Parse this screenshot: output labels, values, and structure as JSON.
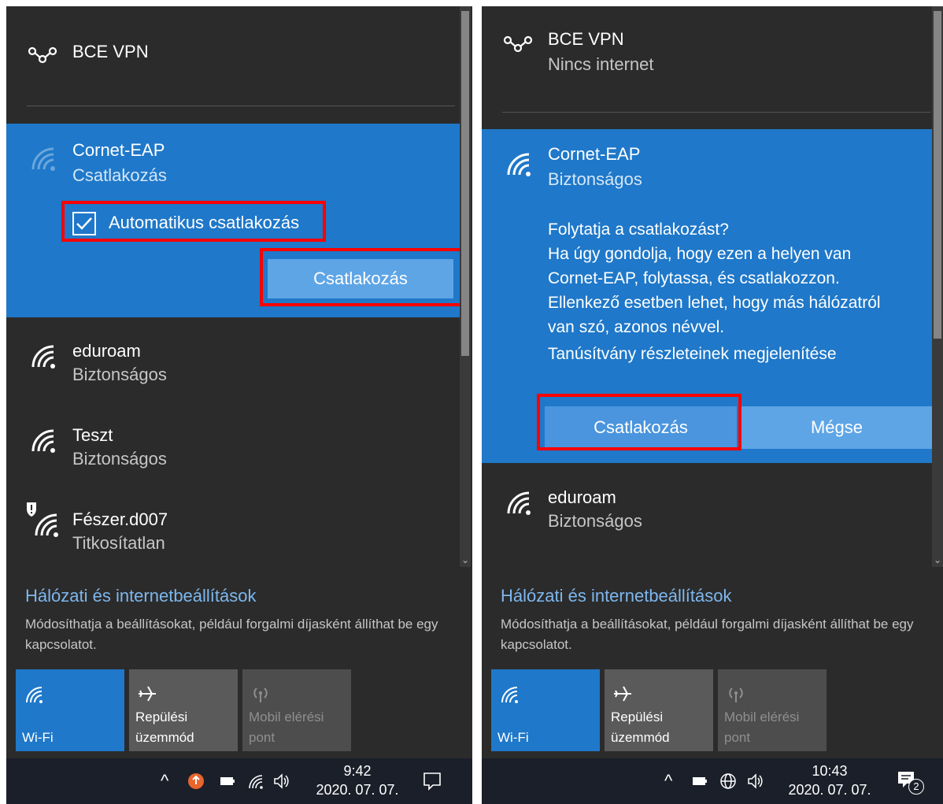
{
  "left_panel": {
    "vpn": {
      "name": "BCE VPN"
    },
    "selected_network": {
      "name": "Cornet-EAP",
      "status": "Csatlakozás",
      "auto_connect_label": "Automatikus csatlakozás",
      "auto_connect_checked": true,
      "connect_button": "Csatlakozás"
    },
    "networks": [
      {
        "name": "eduroam",
        "status": "Biztonságos"
      },
      {
        "name": "Teszt",
        "status": "Biztonságos"
      },
      {
        "name": "Fészer.d007",
        "status": "Titkosítatlan"
      }
    ],
    "settings": {
      "link": "Hálózati és internetbeállítások",
      "description": "Módosíthatja a beállításokat, például forgalmi díjasként állíthat be egy kapcsolatot."
    },
    "tiles": [
      {
        "label": "Wi-Fi",
        "icon": "wifi-icon",
        "active": true
      },
      {
        "label": "Repülési üzemmód",
        "icon": "airplane-icon",
        "active": false
      },
      {
        "label": "Mobil elérési pont",
        "icon": "hotspot-icon",
        "active": false
      }
    ],
    "taskbar": {
      "time": "9:42",
      "date": "2020. 07. 07."
    }
  },
  "right_panel": {
    "vpn": {
      "name": "BCE VPN",
      "status": "Nincs internet"
    },
    "selected_network": {
      "name": "Cornet-EAP",
      "status": "Biztonságos",
      "prompt_lines": [
        "Folytatja a csatlakozást?",
        "Ha úgy gondolja, hogy ezen a helyen van",
        "Cornet-EAP, folytassa, és csatlakozzon.",
        "Ellenkező esetben lehet, hogy más hálózatról",
        "van szó, azonos névvel.",
        "Tanúsítvány részleteinek megjelenítése"
      ],
      "connect_button": "Csatlakozás",
      "cancel_button": "Mégse"
    },
    "networks": [
      {
        "name": "eduroam",
        "status": "Biztonságos"
      }
    ],
    "settings": {
      "link": "Hálózati és internetbeállítások",
      "description": "Módosíthatja a beállításokat, például forgalmi díjasként állíthat be egy kapcsolatot."
    },
    "tiles": [
      {
        "label": "Wi-Fi",
        "icon": "wifi-icon",
        "active": true
      },
      {
        "label": "Repülési üzemmód",
        "icon": "airplane-icon",
        "active": false
      },
      {
        "label": "Mobil elérési pont",
        "icon": "hotspot-icon",
        "active": false
      }
    ],
    "taskbar": {
      "time": "10:43",
      "date": "2020. 07. 07.",
      "notification_count": "2"
    }
  },
  "colors": {
    "panel_bg": "#2b2b2b",
    "accent": "#1f78c9",
    "highlight": "#ff0000"
  }
}
